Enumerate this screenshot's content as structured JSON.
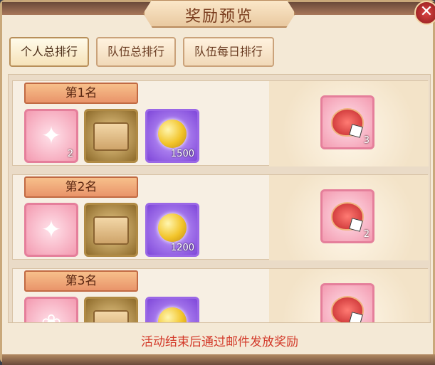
{
  "window": {
    "title": "奖励预览"
  },
  "close_icon": "close-icon",
  "tabs": [
    {
      "label": "个人总排行",
      "active": true
    },
    {
      "label": "队伍总排行",
      "active": false
    },
    {
      "label": "队伍每日排行",
      "active": false
    }
  ],
  "ranks": [
    {
      "label": "第1名",
      "items": [
        {
          "icon": "costume-icon",
          "count": "2"
        },
        {
          "icon": "treasure-box-icon",
          "count": ""
        },
        {
          "icon": "gold-orb-icon",
          "count": "1500"
        }
      ],
      "extra": {
        "icon": "lucky-pouch-icon",
        "count": "3"
      }
    },
    {
      "label": "第2名",
      "items": [
        {
          "icon": "costume-icon",
          "count": ""
        },
        {
          "icon": "treasure-box-icon",
          "count": ""
        },
        {
          "icon": "gold-orb-icon",
          "count": "1200"
        }
      ],
      "extra": {
        "icon": "lucky-pouch-icon",
        "count": "2"
      }
    },
    {
      "label": "第3名",
      "items": [
        {
          "icon": "flower-wreath-icon",
          "count": ""
        },
        {
          "icon": "treasure-box-icon",
          "count": ""
        },
        {
          "icon": "gold-orb-icon",
          "count": ""
        }
      ],
      "extra": {
        "icon": "lucky-pouch-icon",
        "count": ""
      }
    }
  ],
  "footer": "活动结束后通过邮件发放奖励"
}
